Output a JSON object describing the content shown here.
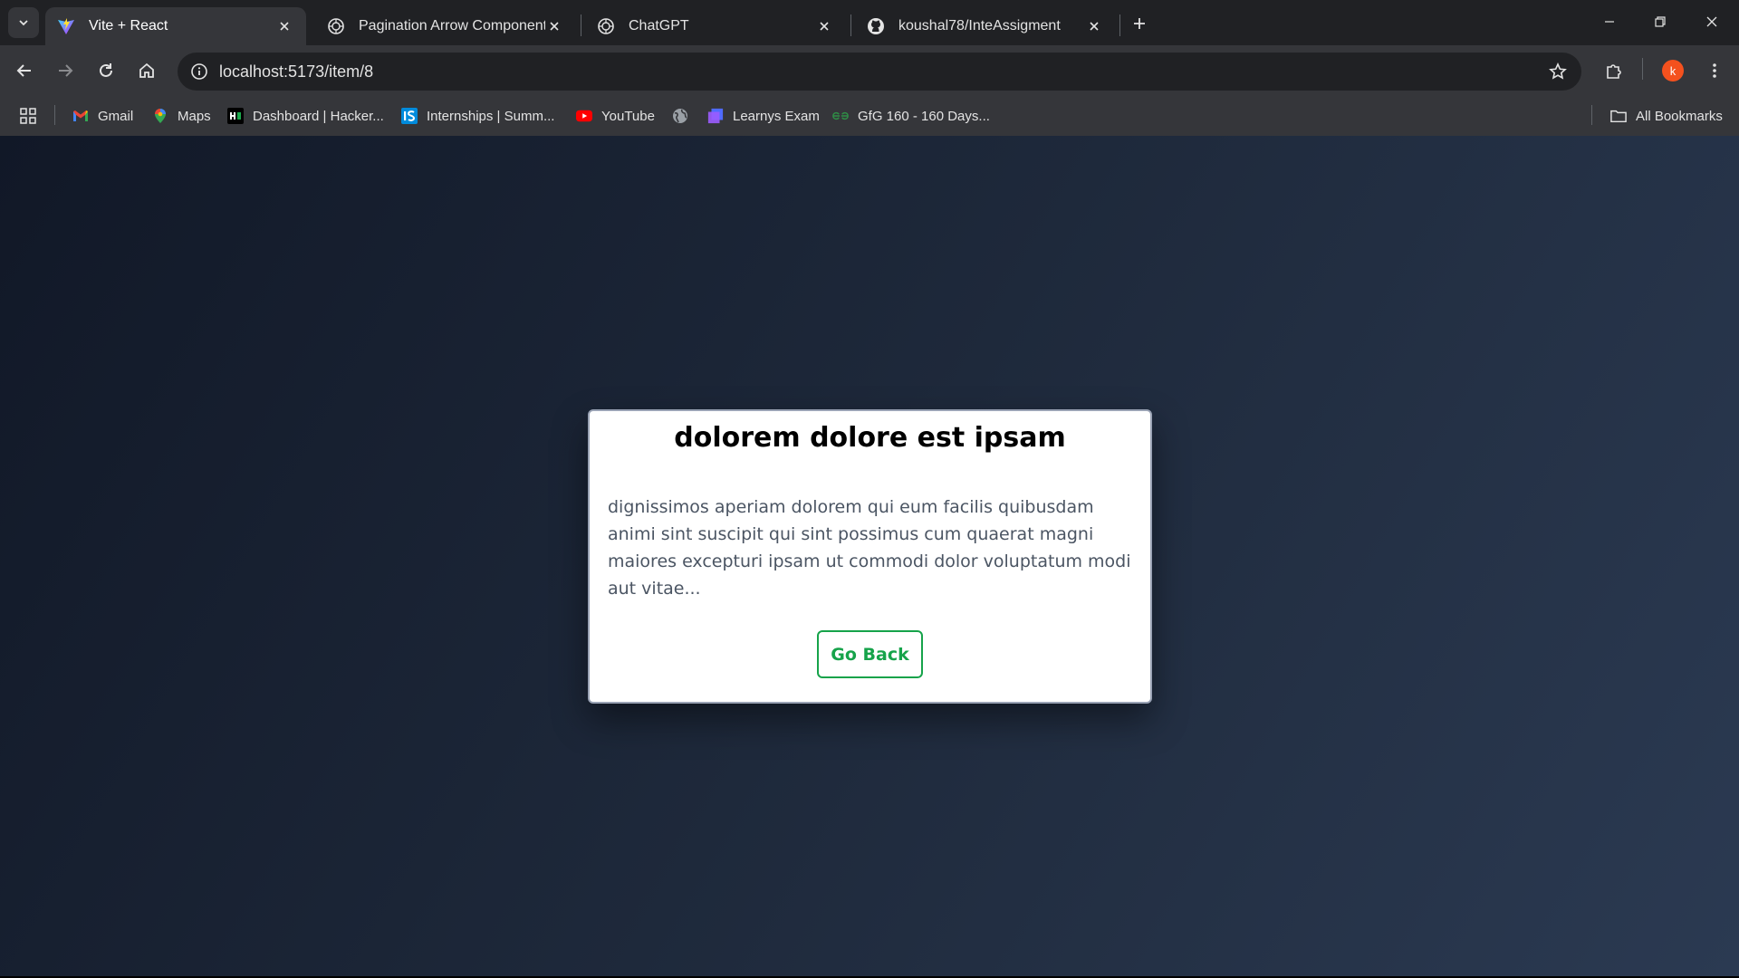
{
  "browser": {
    "tabs": [
      {
        "title": "Vite + React",
        "icon": "vite-icon",
        "active": true
      },
      {
        "title": "Pagination Arrow Component",
        "icon": "chatgpt-icon",
        "active": false
      },
      {
        "title": "ChatGPT",
        "icon": "chatgpt-icon",
        "active": false
      },
      {
        "title": "koushal78/InteAssigment",
        "icon": "github-icon",
        "active": false
      }
    ],
    "address": "localhost:5173/item/8",
    "profile_initial": "k",
    "bookmarks": [
      {
        "label": "Gmail",
        "icon": "gmail-icon"
      },
      {
        "label": "Maps",
        "icon": "maps-icon"
      },
      {
        "label": "Dashboard | Hacker...",
        "icon": "hackerrank-icon"
      },
      {
        "label": "Internships | Summ...",
        "icon": "internshala-icon"
      },
      {
        "label": "YouTube",
        "icon": "youtube-icon"
      },
      {
        "label": "",
        "icon": "globe-icon"
      },
      {
        "label": "Learnys Exam",
        "icon": "learnys-icon"
      },
      {
        "label": "GfG 160 - 160 Days...",
        "icon": "gfg-icon"
      }
    ],
    "all_bookmarks": "All Bookmarks"
  },
  "item": {
    "title": "dolorem dolore est ipsam",
    "body": "dignissimos aperiam dolorem qui eum facilis quibusdam animi sint suscipit qui sint possimus cum quaerat magni maiores excepturi ipsam ut commodi dolor voluptatum modi aut vitae...",
    "back_label": "Go Back"
  },
  "colors": {
    "accent": "#16a34a",
    "page_bg_start": "#111827",
    "page_bg_end": "#2b3a52"
  }
}
